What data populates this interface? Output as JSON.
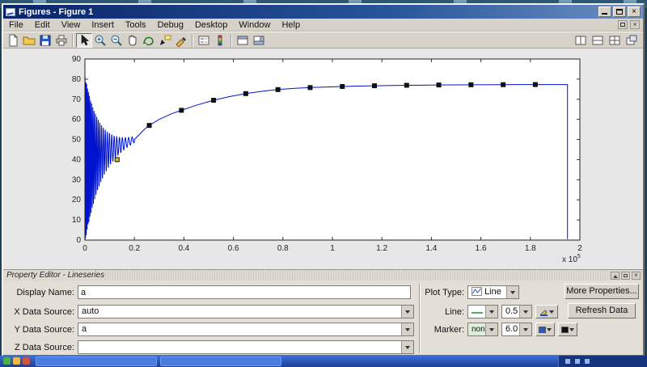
{
  "window": {
    "title": "Figures - Figure 1",
    "glyphs": {
      "close": "×"
    }
  },
  "menubar": {
    "items": [
      "File",
      "Edit",
      "View",
      "Insert",
      "Tools",
      "Debug",
      "Desktop",
      "Window",
      "Help"
    ]
  },
  "property_editor": {
    "title": "Property Editor - Lineseries",
    "fields": {
      "display_name_label": "Display Name:",
      "display_name_value": "a",
      "x_source_label": "X Data Source:",
      "x_source_value": "auto",
      "y_source_label": "Y Data Source:",
      "y_source_value": "a",
      "z_source_label": "Z Data Source:",
      "z_source_value": "",
      "plot_type_label": "Plot Type:",
      "plot_type_value": "Line",
      "line_label": "Line:",
      "line_width_value": "0.5",
      "marker_label": "Marker:",
      "marker_value": "none",
      "marker_size_value": "6.0"
    },
    "buttons": {
      "more_properties": "More Properties...",
      "refresh_data": "Refresh Data"
    }
  },
  "chart_data": {
    "type": "line",
    "series_name": "a",
    "title": "",
    "xlabel": "",
    "ylabel": "",
    "xlim": [
      0,
      2
    ],
    "ylim": [
      0,
      90
    ],
    "x_scale_label": {
      "prefix": "x 10",
      "exp": "5"
    },
    "x_ticks": [
      {
        "v": 0,
        "label": "0"
      },
      {
        "v": 0.2,
        "label": "0.2"
      },
      {
        "v": 0.4,
        "label": "0.4"
      },
      {
        "v": 0.6,
        "label": "0.6"
      },
      {
        "v": 0.8,
        "label": "0.8"
      },
      {
        "v": 1,
        "label": "1"
      },
      {
        "v": 1.2,
        "label": "1.2"
      },
      {
        "v": 1.4,
        "label": "1.4"
      },
      {
        "v": 1.6,
        "label": "1.6"
      },
      {
        "v": 1.8,
        "label": "1.8"
      },
      {
        "v": 2,
        "label": "2"
      }
    ],
    "y_ticks": [
      {
        "v": 0,
        "label": "0"
      },
      {
        "v": 10,
        "label": "10"
      },
      {
        "v": 20,
        "label": "20"
      },
      {
        "v": 30,
        "label": "30"
      },
      {
        "v": 40,
        "label": "40"
      },
      {
        "v": 50,
        "label": "50"
      },
      {
        "v": 60,
        "label": "60"
      },
      {
        "v": 70,
        "label": "70"
      },
      {
        "v": 80,
        "label": "80"
      },
      {
        "v": 90,
        "label": "90"
      }
    ],
    "line_color": "#0013cc",
    "marker_edge": "#111111",
    "oscillation": {
      "x_start": 0,
      "x_end": 0.2,
      "base_start": 40,
      "base_end": 50,
      "amp0": 42,
      "amp_tau": 0.06,
      "period0": 0.003,
      "period_slope": 0.06,
      "step": 0.0004
    },
    "smooth_points": [
      [
        0.2,
        50
      ],
      [
        0.24,
        55
      ],
      [
        0.26,
        57
      ],
      [
        0.3,
        60
      ],
      [
        0.35,
        62.8
      ],
      [
        0.39,
        64.5
      ],
      [
        0.45,
        67
      ],
      [
        0.52,
        69.5
      ],
      [
        0.58,
        71.2
      ],
      [
        0.65,
        72.8
      ],
      [
        0.72,
        74
      ],
      [
        0.78,
        74.8
      ],
      [
        0.85,
        75.4
      ],
      [
        0.91,
        75.8
      ],
      [
        0.98,
        76.1
      ],
      [
        1.04,
        76.35
      ],
      [
        1.1,
        76.55
      ],
      [
        1.17,
        76.7
      ],
      [
        1.24,
        76.85
      ],
      [
        1.3,
        76.95
      ],
      [
        1.43,
        77.1
      ],
      [
        1.56,
        77.2
      ],
      [
        1.69,
        77.25
      ],
      [
        1.82,
        77.3
      ],
      [
        1.93,
        77.3
      ]
    ],
    "end_drop": {
      "x": 1.95,
      "y_top": 77.3,
      "y_bottom": 0.5
    },
    "markers": [
      {
        "x": 0.13,
        "y": 40,
        "fill": "#ddb830"
      },
      {
        "x": 0.26,
        "y": 57,
        "fill": "#111111"
      },
      {
        "x": 0.39,
        "y": 64.5,
        "fill": "#111111"
      },
      {
        "x": 0.52,
        "y": 69.5,
        "fill": "#111111"
      },
      {
        "x": 0.65,
        "y": 72.8,
        "fill": "#111111"
      },
      {
        "x": 0.78,
        "y": 74.8,
        "fill": "#111111"
      },
      {
        "x": 0.91,
        "y": 75.8,
        "fill": "#111111"
      },
      {
        "x": 1.04,
        "y": 76.35,
        "fill": "#111111"
      },
      {
        "x": 1.17,
        "y": 76.7,
        "fill": "#111111"
      },
      {
        "x": 1.3,
        "y": 76.95,
        "fill": "#111111"
      },
      {
        "x": 1.43,
        "y": 77.1,
        "fill": "#111111"
      },
      {
        "x": 1.56,
        "y": 77.2,
        "fill": "#111111"
      },
      {
        "x": 1.69,
        "y": 77.25,
        "fill": "#111111"
      },
      {
        "x": 1.82,
        "y": 77.3,
        "fill": "#111111"
      }
    ]
  }
}
